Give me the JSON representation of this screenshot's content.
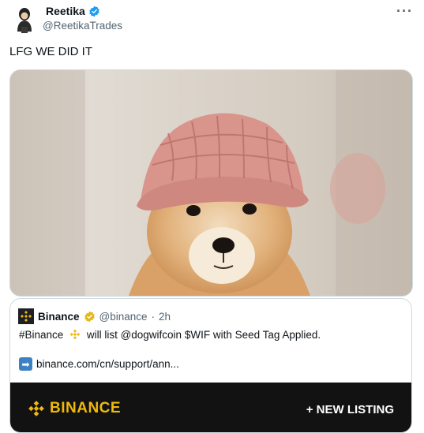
{
  "author": {
    "name": "Reetika",
    "handle": "@ReetikaTrades"
  },
  "more_label": "···",
  "tweet": {
    "text": "LFG WE DID IT"
  },
  "media": {
    "icon": "dog-wearing-pink-knit-hat-photo"
  },
  "quote": {
    "name": "Binance",
    "handle": "@binance",
    "dot": "·",
    "time": "2h",
    "text_prefix": "#Binance",
    "text_suffix": "will list @dogwifcoin $WIF with Seed Tag Applied.",
    "link_text": "binance.com/cn/support/ann...",
    "banner_brand": "BINANCE",
    "banner_listing": "+ NEW LISTING"
  },
  "colors": {
    "verified_blue": "#1d9bf0",
    "binance_yellow": "#f0b90b",
    "banner_bg": "#121212"
  }
}
